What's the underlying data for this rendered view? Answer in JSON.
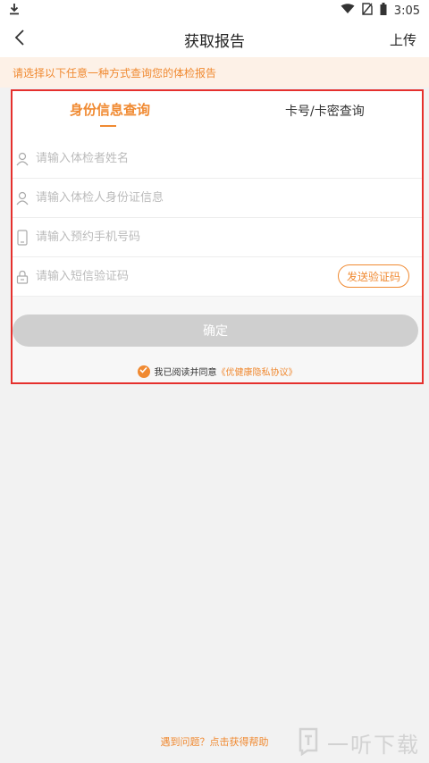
{
  "status_bar": {
    "time": "3:05"
  },
  "nav": {
    "title": "获取报告",
    "upload": "上传"
  },
  "notice": "请选择以下任意一种方式查询您的体检报告",
  "tabs": [
    {
      "label": "身份信息查询",
      "active": true
    },
    {
      "label": "卡号/卡密查询",
      "active": false
    }
  ],
  "form": {
    "name_placeholder": "请输入体检者姓名",
    "id_placeholder": "请输入体检人身份证信息",
    "phone_placeholder": "请输入预约手机号码",
    "code_placeholder": "请输入短信验证码",
    "send_code": "发送验证码",
    "confirm": "确定"
  },
  "agreement": {
    "prefix": "我已阅读并同意",
    "link": "《优健康隐私协议》"
  },
  "help": "遇到问题？点击获得帮助",
  "watermark": "一听下载",
  "colors": {
    "accent": "#f08a32",
    "highlight_border": "#e5302d",
    "disabled_button": "#cfcfcf"
  }
}
